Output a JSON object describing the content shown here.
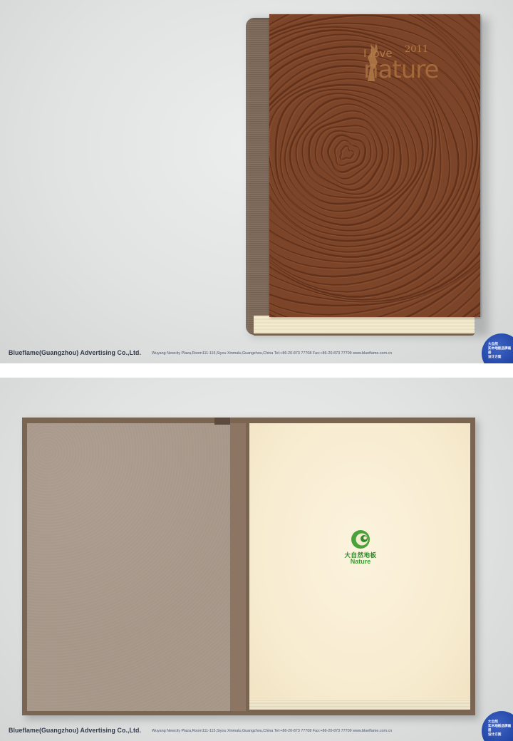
{
  "footer": {
    "company": "Blueflame(Guangzhou) Advertising Co.,Ltd.",
    "address": "Wuyang Newcity Plaza,Room111-115,Siyou Xinmalu,Guangzhou,China  Tel:+86-20-873 77708  Fax:+86-20-873 77709  www.blueflame.com.cn",
    "badge_lines": [
      "大自然",
      "实木地板品牌画册",
      "设计方案"
    ]
  },
  "cover": {
    "i_love": "I love",
    "year": "2011",
    "nature": "nature"
  },
  "inner_page": {
    "logo_cn": "大自然地板",
    "logo_en": "Nature"
  },
  "colors": {
    "wood": "#7a4327",
    "spine": "#7d6a5c",
    "paper": "#f7ebcf",
    "logo_green": "#3c9a33",
    "badge_blue": "#1c3f9e"
  }
}
